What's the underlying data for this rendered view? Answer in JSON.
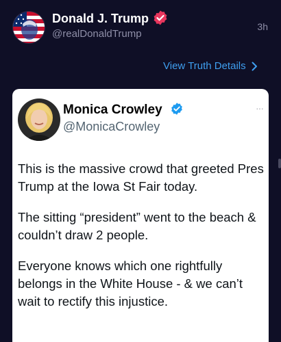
{
  "post": {
    "author_name": "Donald J. Trump",
    "author_handle": "@realDonaldTrump",
    "time_ago": "3h",
    "view_details_label": "View Truth Details",
    "icons": {
      "verified": "verified-badge-icon",
      "chevron": "chevron-right-icon"
    },
    "colors": {
      "background": "#0f0f26",
      "link": "#3f9ff0",
      "verified_badge": "#e8365d"
    }
  },
  "quoted_tweet": {
    "author_name": "Monica Crowley",
    "author_handle": "@MonicaCrowley",
    "more_label": "···",
    "paragraphs": [
      "This is the massive crowd that greeted Pres Trump at the Iowa St Fair today.",
      "The sitting “president” went to the beach & couldn’t draw 2 people.",
      "Everyone knows which one rightfully belongs in the White House - & we can’t wait to rectify this injustice."
    ],
    "colors": {
      "verified_badge": "#1d9bf0"
    }
  }
}
